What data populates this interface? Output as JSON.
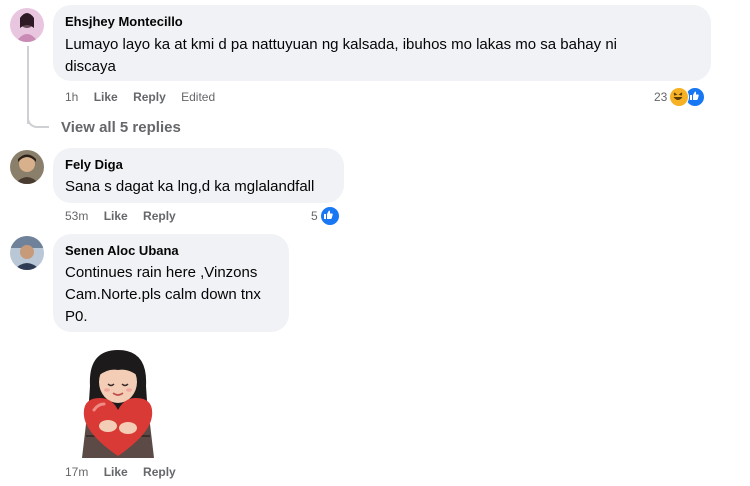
{
  "comments": [
    {
      "author": "Ehsjhey Montecillo",
      "text_lines": [
        "Lumayo layo ka at kmi d pa nattuyuan ng kalsada, ibuhos mo lakas mo sa bahay ni",
        "discaya"
      ],
      "time": "1h",
      "like": "Like",
      "reply": "Reply",
      "edited": "Edited",
      "reaction_count": "23",
      "reaction_icons": [
        "haha-icon",
        "like-icon"
      ]
    },
    {
      "author": "Fely Diga",
      "text_lines": [
        "Sana s dagat ka lng,d ka mglalandfall"
      ],
      "time": "53m",
      "like": "Like",
      "reply": "Reply",
      "reaction_count": "5",
      "reaction_icons": [
        "like-icon"
      ]
    },
    {
      "author": "Senen Aloc Ubana",
      "text_lines": [
        "Continues rain here ,Vinzons",
        "Cam.Norte.pls calm down tnx",
        "P0."
      ],
      "time": "17m",
      "like": "Like",
      "reply": "Reply",
      "sticker": "girl-hugging-heart-sticker"
    }
  ],
  "view_replies": "View all 5 replies",
  "colors": {
    "bubble": "#f0f2f5",
    "meta": "#65676b",
    "like_blue": "#1877f2",
    "haha_yellow": "#f7b125"
  }
}
